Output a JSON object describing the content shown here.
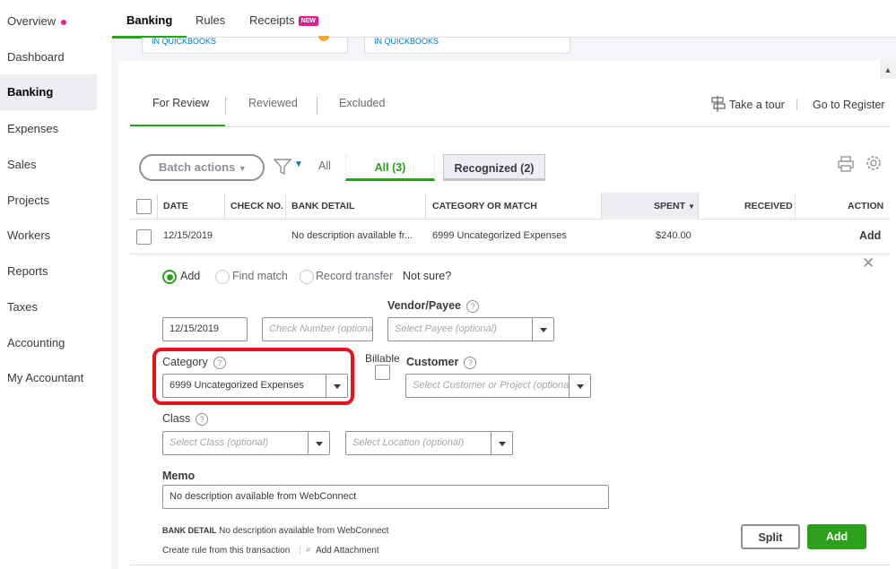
{
  "sidebar": {
    "items": [
      {
        "label": "Overview"
      },
      {
        "label": "Dashboard"
      },
      {
        "label": "Banking"
      },
      {
        "label": "Expenses"
      },
      {
        "label": "Sales"
      },
      {
        "label": "Projects"
      },
      {
        "label": "Workers"
      },
      {
        "label": "Reports"
      },
      {
        "label": "Taxes"
      },
      {
        "label": "Accounting"
      },
      {
        "label": "My Accountant"
      }
    ]
  },
  "topnav": {
    "tabs": [
      {
        "label": "Banking"
      },
      {
        "label": "Rules"
      },
      {
        "label": "Receipts"
      }
    ],
    "new_badge": "NEW"
  },
  "accounts": {
    "card1": "IN QUICKBOOKS",
    "card2": "IN QUICKBOOKS"
  },
  "subtabs": [
    "For Review",
    "Reviewed",
    "Excluded"
  ],
  "links": {
    "tour": "Take a tour",
    "register": "Go to Register"
  },
  "toolbar": {
    "batch_actions": "Batch actions",
    "all_text": "All",
    "filter_all": "All (3)",
    "filter_recognized": "Recognized (2)"
  },
  "table": {
    "headers": [
      "DATE",
      "CHECK NO.",
      "BANK DETAIL",
      "CATEGORY OR MATCH",
      "SPENT",
      "RECEIVED",
      "ACTION"
    ],
    "row": {
      "date": "12/15/2019",
      "bank_detail": "No description available fr...",
      "category": "6999 Uncategorized Expenses",
      "spent": "$240.00",
      "action": "Add"
    }
  },
  "form": {
    "radios": [
      "Add",
      "Find match",
      "Record transfer"
    ],
    "not_sure": "Not sure?",
    "date_value": "12/15/2019",
    "check_placeholder": "Check Number (optional)",
    "vendor_label": "Vendor/Payee",
    "vendor_placeholder": "Select Payee (optional)",
    "category_label": "Category",
    "category_value": "6999 Uncategorized Expenses",
    "billable_label": "Billable",
    "customer_label": "Customer",
    "customer_placeholder": "Select Customer or Project (optional)",
    "class_label": "Class",
    "class_placeholder": "Select Class (optional)",
    "location_placeholder": "Select Location (optional)",
    "memo_label": "Memo",
    "memo_value": "No description available from WebConnect",
    "bank_detail_label": "BANK DETAIL",
    "bank_detail_value": "No description available from WebConnect",
    "create_rule": "Create rule from this transaction",
    "add_attachment": "Add Attachment",
    "split_label": "Split",
    "add_label": "Add"
  },
  "colors": {
    "accent_green": "#2ca01c",
    "link_blue": "#0077c5",
    "highlight_red": "#e8121d",
    "badge_pink": "#e1208f"
  }
}
